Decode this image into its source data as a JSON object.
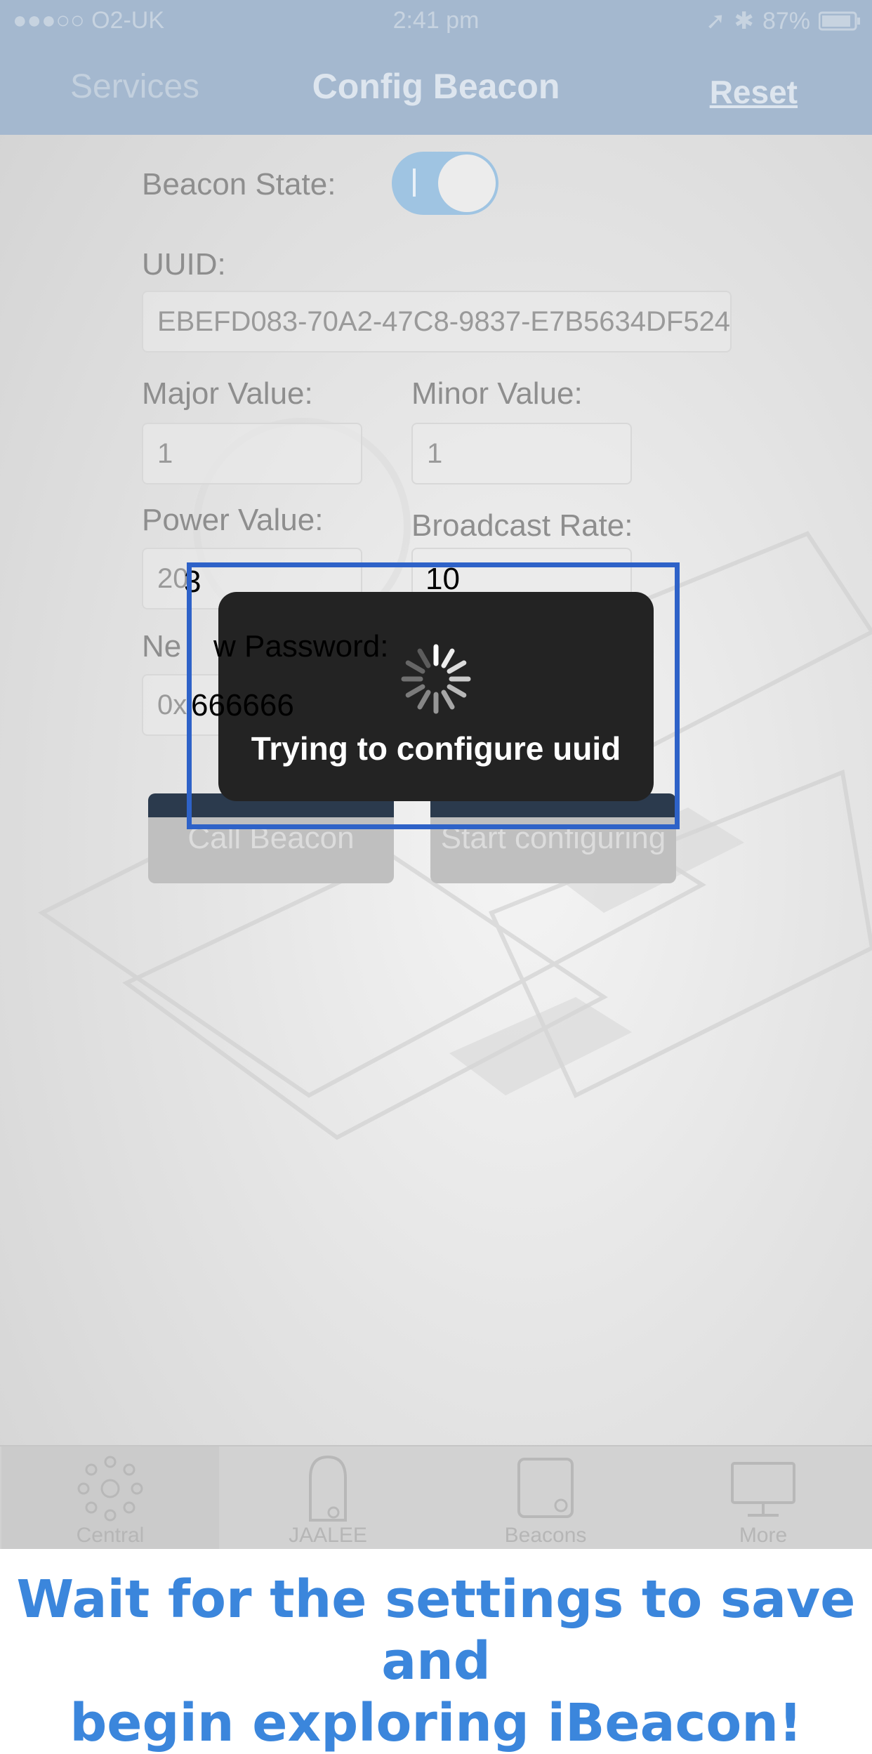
{
  "status_bar": {
    "carrier": "●●●○○ O2-UK",
    "time": "2:41 pm",
    "battery": "87%"
  },
  "nav": {
    "back_label": "Services",
    "title": "Config Beacon",
    "reset_label": "Reset"
  },
  "form": {
    "beacon_state_label": "Beacon State:",
    "beacon_state_on": true,
    "uuid_label": "UUID:",
    "uuid_value": "EBEFD083-70A2-47C8-9837-E7B5634DF524",
    "major_label": "Major Value:",
    "major_value": "1",
    "minor_label": "Minor Value:",
    "minor_value": "1",
    "power_label": "Power Value:",
    "power_value_left": "20",
    "power_value_right": "3",
    "rate_label": "Broadcast Rate:",
    "rate_value": "10",
    "password_label_left": "Ne",
    "password_label_right": "w Password:",
    "password_value_left": "0x",
    "password_value_right": "666666"
  },
  "buttons": {
    "call_label": "Call Beacon",
    "start_label": "Start configuring"
  },
  "hud": {
    "message": "Trying to configure uuid"
  },
  "tabs": [
    {
      "label": "Central",
      "icon": "central-dots-icon",
      "active": true
    },
    {
      "label": "JAALEE",
      "icon": "beacon-device-icon",
      "active": false
    },
    {
      "label": "Beacons",
      "icon": "beacon-square-icon",
      "active": false
    },
    {
      "label": "More",
      "icon": "monitor-icon",
      "active": false
    }
  ],
  "caption": {
    "line1": "Wait for the settings to save and",
    "line2": "begin exploring iBeacon!"
  },
  "colors": {
    "nav_background": "#a4b8cf",
    "highlight_border": "#2e62c8",
    "caption_text": "#3b86dc"
  }
}
